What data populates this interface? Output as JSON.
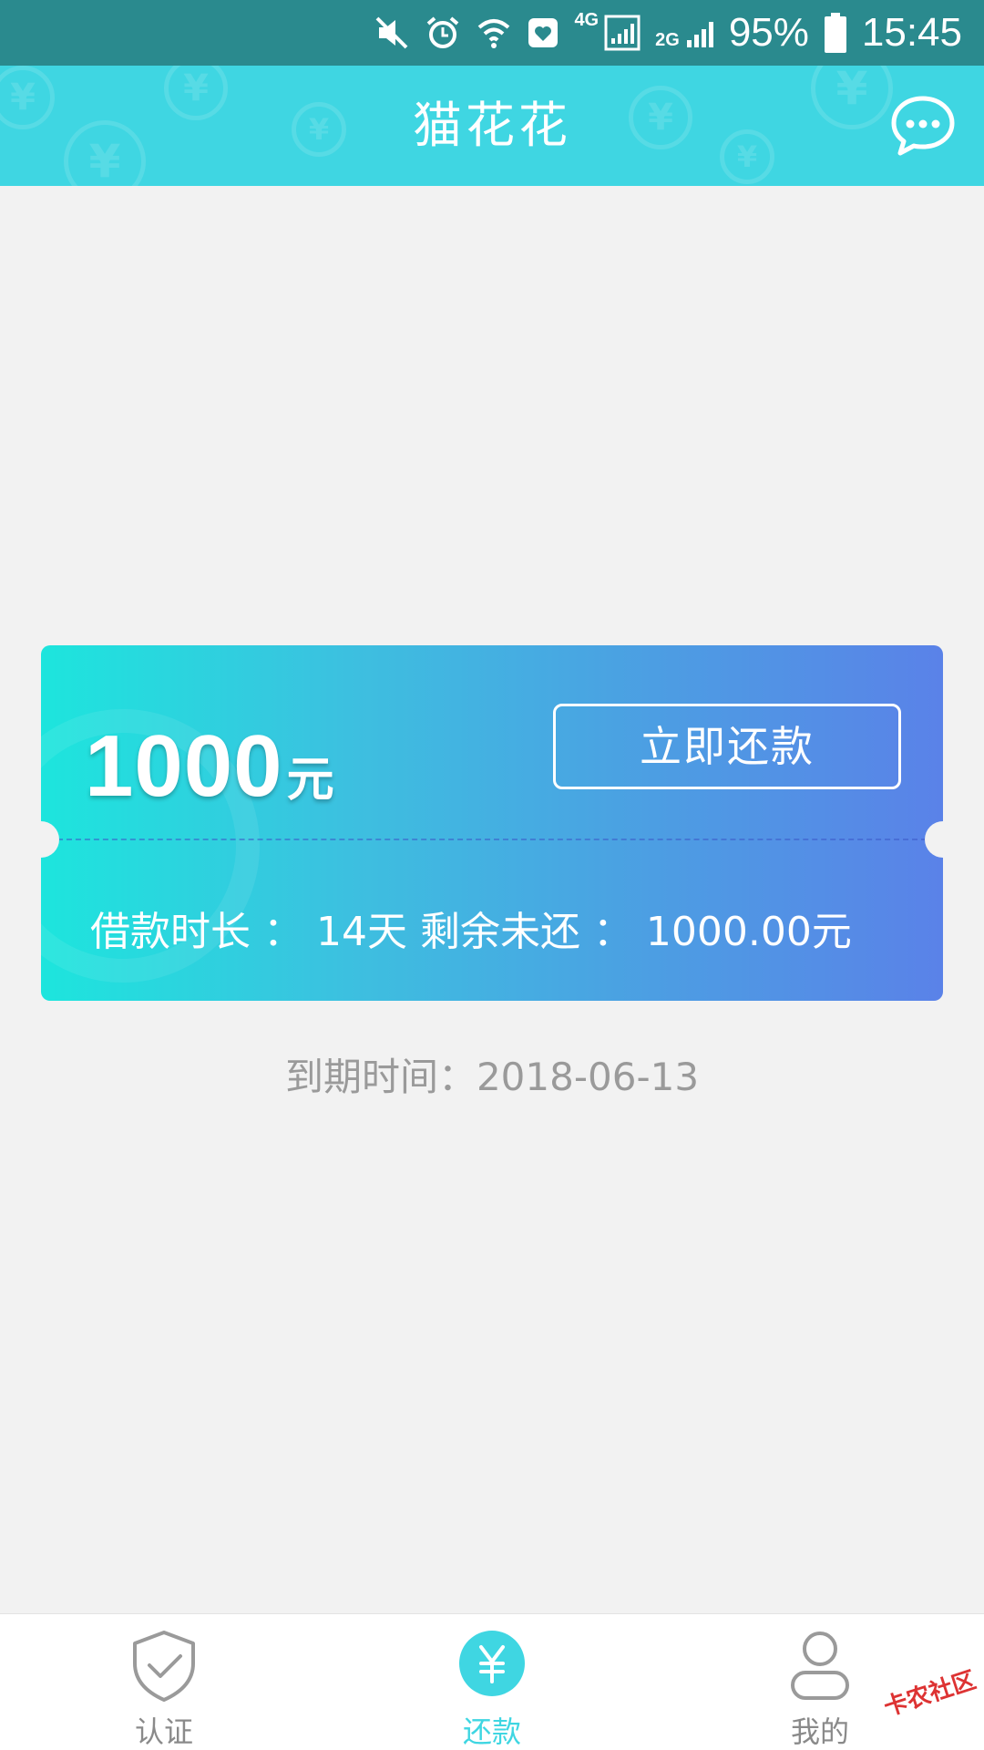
{
  "status_bar": {
    "icons": [
      "mute-icon",
      "alarm-icon",
      "wifi-icon",
      "health-icon",
      "signal-4g-icon",
      "signal-2g-icon",
      "battery-icon"
    ],
    "network_4g": "4G",
    "network_2g": "2G",
    "battery": "95%",
    "time": "15:45"
  },
  "header": {
    "title": "猫花花",
    "chat_icon": "chat-bubble-icon",
    "coin_symbol": "¥",
    "background_color": "#3fd6e2"
  },
  "loan_card": {
    "amount": "1000",
    "amount_unit": "元",
    "repay_button_label": "立即还款",
    "detail": "借款时长 ： 14天 剩余未还 ： 1000.00元",
    "gradient_colors": [
      "#1de5dd",
      "#5a82e8"
    ]
  },
  "due_date": "到期时间：2018-06-13",
  "bottom_nav": {
    "items": [
      {
        "label": "认证",
        "icon": "shield-check-icon",
        "active": false
      },
      {
        "label": "还款",
        "icon": "yuan-coin-icon",
        "active": true
      },
      {
        "label": "我的",
        "icon": "user-icon",
        "active": false
      }
    ],
    "active_color": "#3fd6e2"
  },
  "watermark": "卡农社区"
}
